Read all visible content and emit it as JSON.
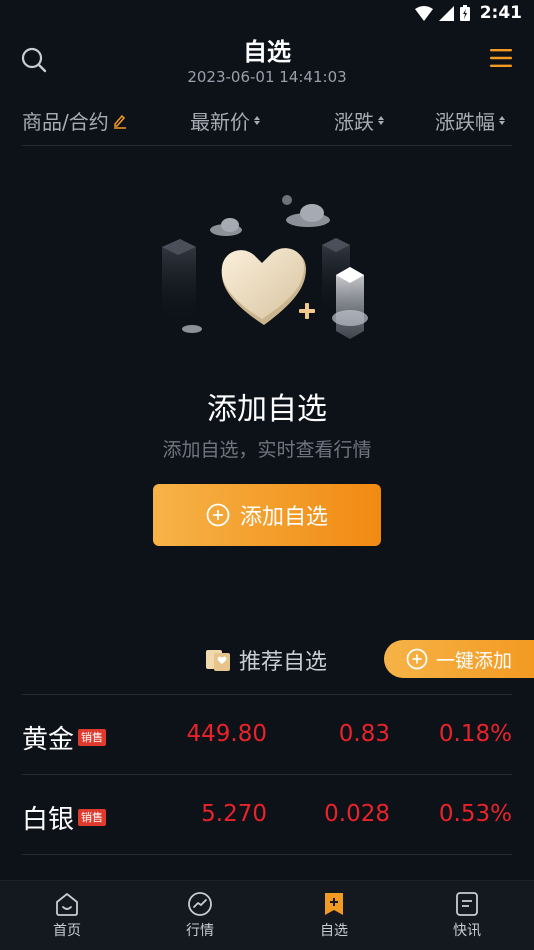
{
  "status_bar": {
    "time": "2:41"
  },
  "header": {
    "title": "自选",
    "datetime": "2023-06-01 14:41:03"
  },
  "columns": {
    "name": "商品/合约",
    "price": "最新价",
    "change": "涨跌",
    "pct": "涨跌幅"
  },
  "empty_state": {
    "title": "添加自选",
    "subtitle": "添加自选，实时查看行情",
    "button_label": "添加自选"
  },
  "recommend": {
    "title": "推荐自选",
    "one_click_label": "一键添加",
    "items": [
      {
        "name": "黄金",
        "badge": "销售",
        "price": "449.80",
        "change": "0.83",
        "pct": "0.18%"
      },
      {
        "name": "白银",
        "badge": "销售",
        "price": "5.270",
        "change": "0.028",
        "pct": "0.53%"
      }
    ]
  },
  "bottom_nav": {
    "items": [
      {
        "label": "首页"
      },
      {
        "label": "行情"
      },
      {
        "label": "自选"
      },
      {
        "label": "快讯"
      }
    ]
  },
  "colors": {
    "accent": "#f39a22",
    "up": "#e8232a",
    "background": "#0d1118"
  }
}
